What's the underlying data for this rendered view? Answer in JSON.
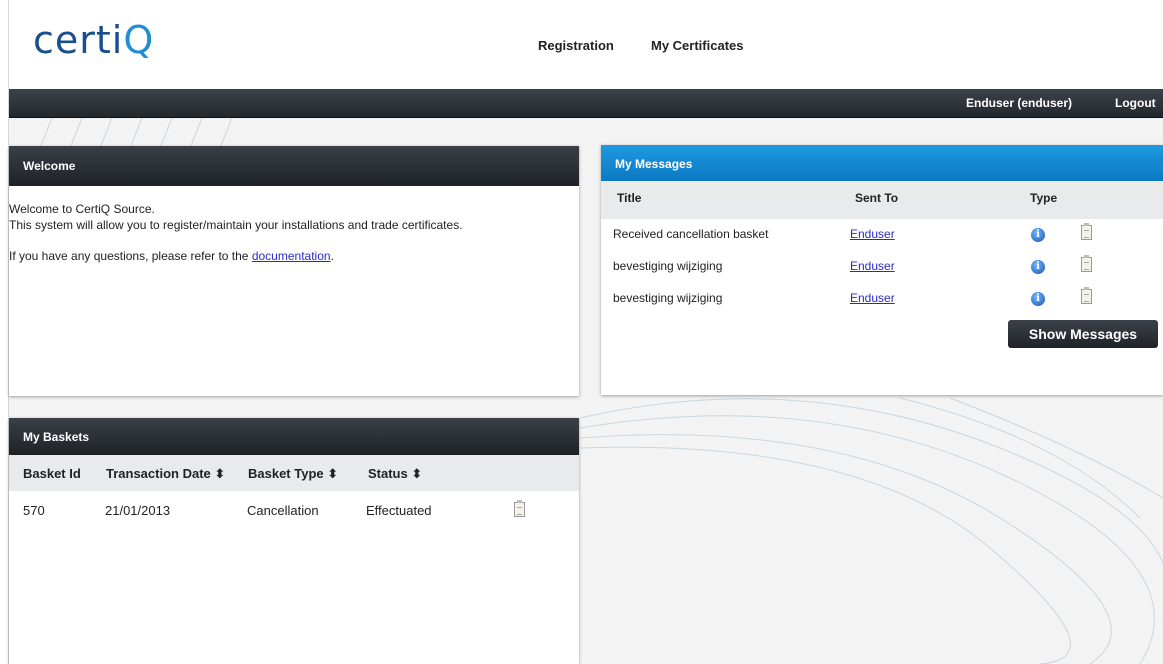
{
  "logo": {
    "text_main": "certi",
    "text_accent": "Q"
  },
  "topnav": {
    "registration": "Registration",
    "my_certificates": "My Certificates"
  },
  "userbar": {
    "user": "Enduser (enduser)",
    "logout": "Logout"
  },
  "welcome": {
    "title": "Welcome",
    "line1": "Welcome to CertiQ Source.",
    "line2": "This system will allow you to register/maintain your installations and trade certificates.",
    "question_prefix": "If you have any questions, please refer to the ",
    "doc_link": "documentation",
    "question_suffix": "."
  },
  "messages": {
    "title": "My Messages",
    "columns": {
      "title": "Title",
      "sent_to": "Sent To",
      "type": "Type"
    },
    "rows": [
      {
        "title": "Received cancellation basket",
        "sent_to": "Enduser"
      },
      {
        "title": "bevestiging wijziging",
        "sent_to": "Enduser"
      },
      {
        "title": "bevestiging wijziging",
        "sent_to": "Enduser"
      }
    ],
    "show_button": "Show Messages"
  },
  "baskets": {
    "title": "My Baskets",
    "columns": {
      "id": "Basket Id",
      "date": "Transaction Date ⬍",
      "type": "Basket Type ⬍",
      "status": "Status ⬍"
    },
    "rows": [
      {
        "id": "570",
        "date": "21/01/2013",
        "type": "Cancellation",
        "status": "Effectuated"
      }
    ]
  },
  "colors": {
    "accent_blue": "#0a78c2",
    "dark": "#23282d",
    "logo_blue": "#1a4e8c"
  },
  "icons": [
    "info-icon",
    "document-icon"
  ]
}
